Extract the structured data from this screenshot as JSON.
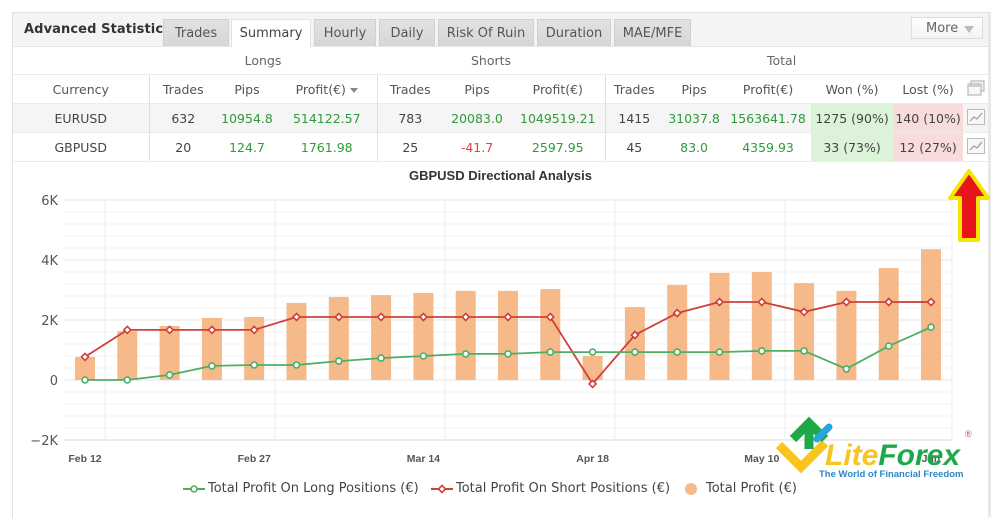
{
  "header": {
    "title": "Advanced Statistics",
    "tabs": [
      {
        "label": "Trades",
        "active": false
      },
      {
        "label": "Summary",
        "active": true
      },
      {
        "label": "Hourly",
        "active": false
      },
      {
        "label": "Daily",
        "active": false
      },
      {
        "label": "Risk Of Ruin",
        "active": false
      },
      {
        "label": "Duration",
        "active": false
      },
      {
        "label": "MAE/MFE",
        "active": false
      }
    ],
    "more_label": "More"
  },
  "table": {
    "groups": {
      "longs": "Longs",
      "shorts": "Shorts",
      "total": "Total"
    },
    "columns": [
      "Currency",
      "Trades",
      "Pips",
      "Profit(€)",
      "Trades",
      "Pips",
      "Profit(€)",
      "Trades",
      "Pips",
      "Profit(€)",
      "Won (%)",
      "Lost (%)"
    ],
    "sorted_column_index": 3,
    "header_icon": "popout-window-icon",
    "row_icon": "line-chart-icon",
    "rows": [
      {
        "currency": "EURUSD",
        "long_trades": "632",
        "long_pips": "10954.8",
        "long_profit": "514122.57",
        "short_trades": "783",
        "short_pips": "20083.0",
        "short_profit": "1049519.21",
        "total_trades": "1415",
        "total_pips": "31037.8",
        "total_profit": "1563641.78",
        "won": "1275 (90%)",
        "lost": "140 (10%)"
      },
      {
        "currency": "GBPUSD",
        "long_trades": "20",
        "long_pips": "124.7",
        "long_profit": "1761.98",
        "short_trades": "25",
        "short_pips": "-41.7",
        "short_profit": "2597.95",
        "total_trades": "45",
        "total_pips": "83.0",
        "total_profit": "4359.93",
        "won": "33 (73%)",
        "lost": "12 (27%)"
      }
    ]
  },
  "colors": {
    "positive": "#2f9a3c",
    "negative": "#e2433f",
    "won_bg": "#dbf4d8",
    "lost_bg": "#f8dcdc",
    "bar": "#f5b98a",
    "long_line": "#4caf62",
    "short_line": "#d0403a",
    "arrow_fill": "#e8141b",
    "arrow_outline": "#f7e600"
  },
  "annotation": {
    "icon": "red-up-arrow-icon"
  },
  "watermark": {
    "brand": "LiteForex",
    "brand_part1": "Lite",
    "brand_part2": "Forex",
    "tagline": "The World of Financial Freedom",
    "registered": "®"
  },
  "chart_data": {
    "type": "bar",
    "title": "GBPUSD Directional Analysis",
    "xlabel": "",
    "ylabel": "",
    "ylim": [
      -2000,
      6000
    ],
    "yticks": [
      -2000,
      0,
      2000,
      4000,
      6000
    ],
    "ytick_labels": [
      "−2K",
      "0",
      "2K",
      "4K",
      "6K"
    ],
    "xtick_labels": [
      {
        "label": "Feb 12",
        "index": 0
      },
      {
        "label": "Feb 27",
        "index": 4
      },
      {
        "label": "Mar 14",
        "index": 8
      },
      {
        "label": "Apr 18",
        "index": 12
      },
      {
        "label": "May 10",
        "index": 16
      },
      {
        "label": "Jun",
        "index": 20
      }
    ],
    "grid": true,
    "legend_position": "bottom",
    "point_count": 21,
    "series": [
      {
        "name": "Total Profit On Long Positions (€)",
        "kind": "line",
        "marker": "circle",
        "values": [
          0,
          0,
          170,
          470,
          500,
          500,
          630,
          730,
          800,
          870,
          870,
          930,
          930,
          930,
          930,
          930,
          970,
          970,
          370,
          1130,
          1762
        ]
      },
      {
        "name": "Total Profit On Short Positions (€)",
        "kind": "line",
        "marker": "diamond",
        "values": [
          770,
          1670,
          1670,
          1670,
          1670,
          2100,
          2100,
          2100,
          2100,
          2100,
          2100,
          2100,
          -130,
          1500,
          2230,
          2600,
          2600,
          2270,
          2600,
          2600,
          2598
        ]
      },
      {
        "name": "Total Profit (€)",
        "kind": "bar",
        "marker": "circle",
        "values": [
          770,
          1630,
          1800,
          2070,
          2100,
          2570,
          2770,
          2830,
          2900,
          2970,
          2970,
          3030,
          800,
          2430,
          3170,
          3570,
          3600,
          3230,
          2970,
          3730,
          4360
        ]
      }
    ]
  }
}
